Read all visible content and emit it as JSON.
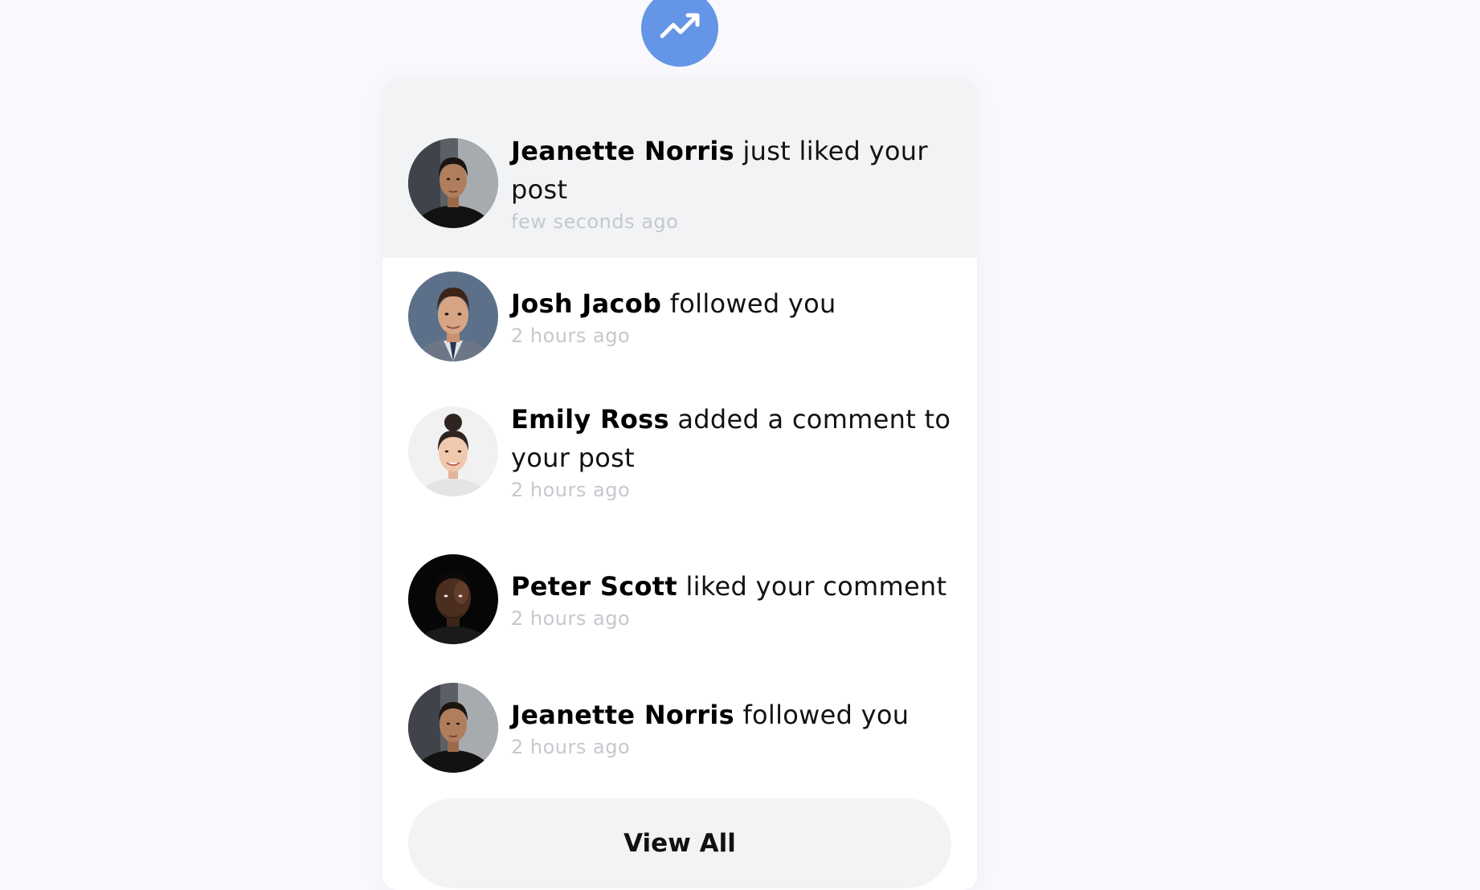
{
  "header": {
    "icon": "trending-up-icon",
    "badge_color": "#6495e6"
  },
  "notifications": [
    {
      "name": "Jeanette Norris",
      "action": " just liked your post",
      "time": "few seconds ago",
      "avatar": "avatar-jeanette-norris",
      "highlighted": true
    },
    {
      "name": "Josh Jacob",
      "action": " followed you",
      "time": "2 hours ago",
      "avatar": "avatar-josh-jacob",
      "highlighted": false
    },
    {
      "name": "Emily Ross",
      "action": " added a comment to your post",
      "time": "2 hours ago",
      "avatar": "avatar-emily-ross",
      "highlighted": false
    },
    {
      "name": "Peter Scott",
      "action": " liked your comment",
      "time": "2 hours ago",
      "avatar": "avatar-peter-scott",
      "highlighted": false
    },
    {
      "name": "Jeanette Norris",
      "action": " followed you",
      "time": "2 hours ago",
      "avatar": "avatar-jeanette-norris",
      "highlighted": false
    }
  ],
  "footer": {
    "view_all_label": "View All"
  }
}
